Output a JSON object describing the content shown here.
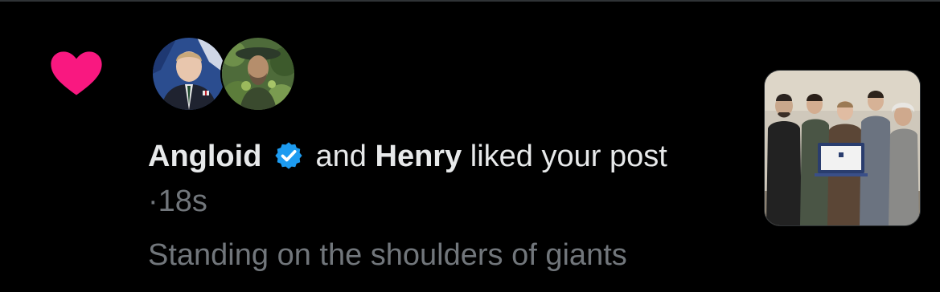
{
  "notification": {
    "type_icon": "heart-icon",
    "icon_color": "#f91880",
    "users": [
      {
        "display_name": "Angloid",
        "verified": true,
        "avatar": "avatar-angloid"
      },
      {
        "display_name": "Henry",
        "verified": false,
        "avatar": "avatar-henry"
      }
    ],
    "connector": "and",
    "action": "liked your",
    "object": "post",
    "separator": "·",
    "timestamp": "18s",
    "post_text": "Standing on the shoulders of giants",
    "verified_color": "#1d9bf0",
    "text_color": "#e7e9ea",
    "muted_color": "#71767b"
  }
}
